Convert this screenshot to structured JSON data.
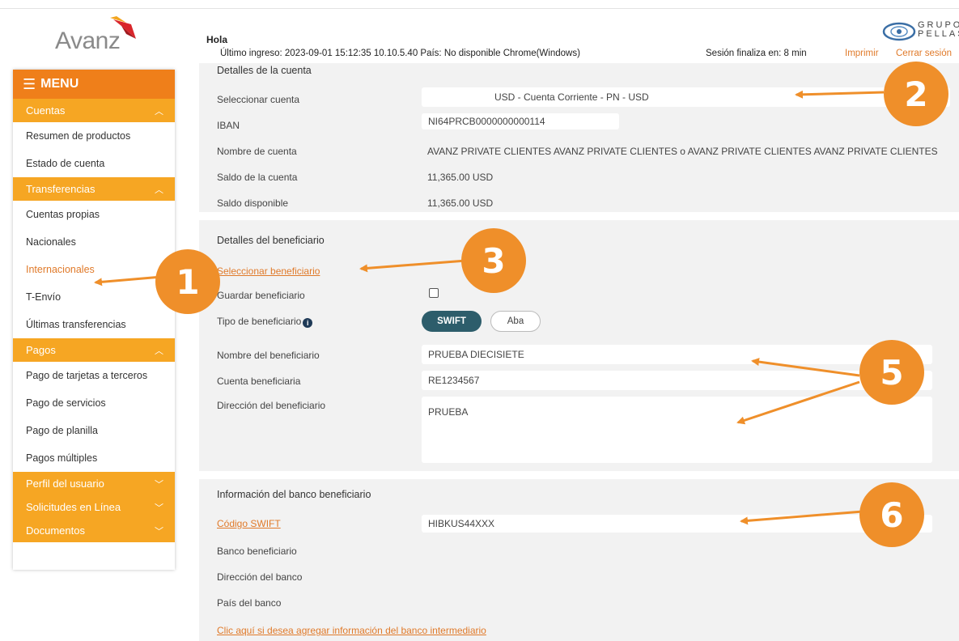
{
  "brand": {
    "logo_text": "Avanz",
    "group_logo_text": "GRUPO\nPELLAS",
    "accent_color": "#ef7f1a",
    "section_color": "#f6a623",
    "link_color": "#e07a2a"
  },
  "header": {
    "greeting": "Hola",
    "last_login": "Último ingreso: 2023-09-01 15:12:35 10.10.5.40 País: No disponible Chrome(Windows)",
    "session_timer": "Sesión finaliza en: 8 min",
    "print": "Imprimir",
    "logout": "Cerrar sesión"
  },
  "sidebar": {
    "menu_label": "MENU",
    "sections": [
      {
        "label": "Cuentas",
        "chevron": "up",
        "items": [
          "Resumen de productos",
          "Estado de cuenta"
        ]
      },
      {
        "label": "Transferencias",
        "chevron": "up",
        "items": [
          "Cuentas propias",
          "Nacionales",
          "Internacionales",
          "T-Envío",
          "Últimas transferencias"
        ]
      },
      {
        "label": "Pagos",
        "chevron": "up",
        "items": [
          "Pago de tarjetas a terceros",
          "Pago de servicios",
          "Pago de planilla",
          "Pagos múltiples"
        ]
      },
      {
        "label": "Perfil del usuario",
        "chevron": "down",
        "items": []
      },
      {
        "label": "Solicitudes en Línea",
        "chevron": "down",
        "items": []
      },
      {
        "label": "Documentos",
        "chevron": "down",
        "items": []
      }
    ],
    "active_item": "Internacionales"
  },
  "account": {
    "title": "Detalles de la cuenta",
    "select_label": "Seleccionar cuenta",
    "select_value": "USD - Cuenta Corriente - PN - USD",
    "iban_label": "IBAN",
    "iban_value": "NI64PRCB0000000000114",
    "name_label": "Nombre de cuenta",
    "name_value": "AVANZ PRIVATE CLIENTES AVANZ PRIVATE CLIENTES o AVANZ PRIVATE CLIENTES AVANZ PRIVATE CLIENTES",
    "balance_label": "Saldo de la cuenta",
    "balance_value": "11,365.00 USD",
    "available_label": "Saldo disponible",
    "available_value": "11,365.00 USD"
  },
  "beneficiary": {
    "title": "Detalles del beneficiario",
    "select_link": "Seleccionar beneficiario",
    "save_label": "Guardar beneficiario",
    "save_checked": false,
    "type_label": "Tipo de beneficiario",
    "type_options": [
      "SWIFT",
      "Aba"
    ],
    "type_selected": "SWIFT",
    "name_label": "Nombre del beneficiario",
    "name_value": "PRUEBA DIECISIETE",
    "account_label": "Cuenta beneficiaria",
    "account_value": "RE1234567",
    "address_label": "Dirección del beneficiario",
    "address_value": "PRUEBA"
  },
  "bank": {
    "title": "Información del banco beneficiario",
    "swift_label": "Código SWIFT",
    "swift_value": "HIBKUS44XXX",
    "bank_label": "Banco beneficiario",
    "bank_address_label": "Dirección del banco",
    "bank_country_label": "País del banco",
    "intermediary_link": "Clic aquí si desea agregar información del banco intermediario"
  },
  "annotations": [
    "1",
    "2",
    "3",
    "5",
    "6"
  ]
}
